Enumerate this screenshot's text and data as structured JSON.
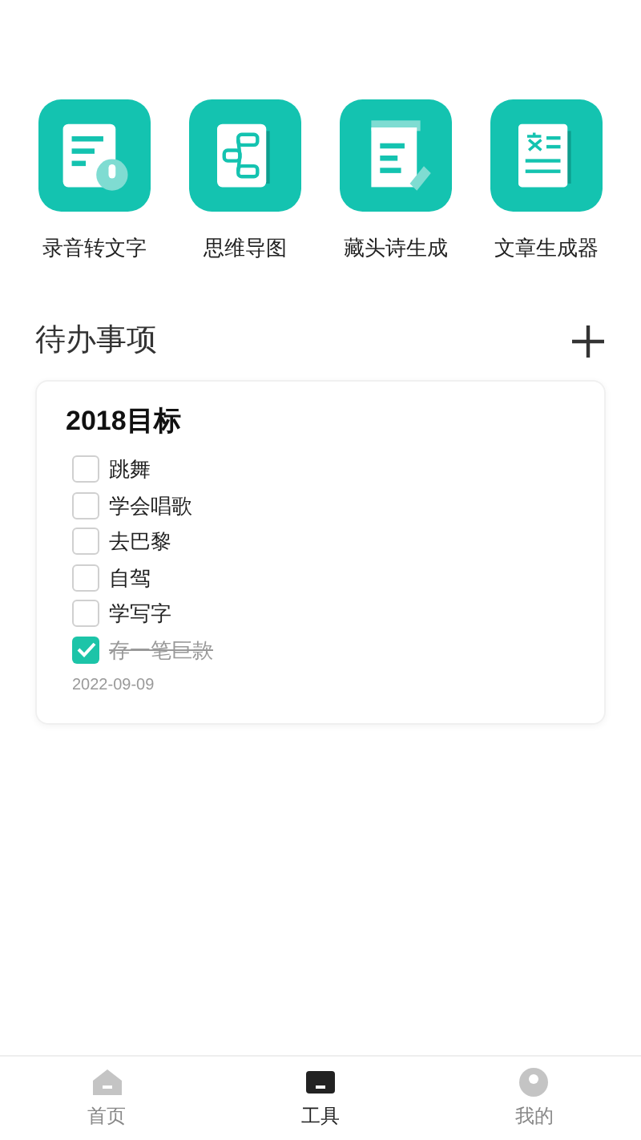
{
  "tools": [
    {
      "label": "录音转文字",
      "kind": "voice"
    },
    {
      "label": "思维导图",
      "kind": "mindmap"
    },
    {
      "label": "藏头诗生成",
      "kind": "poem"
    },
    {
      "label": "文章生成器",
      "kind": "article"
    }
  ],
  "todo": {
    "heading": "待办事项",
    "card": {
      "title": "2018目标",
      "items": [
        {
          "text": "跳舞",
          "checked": false
        },
        {
          "text": "学会唱歌",
          "checked": false
        },
        {
          "text": "去巴黎",
          "checked": false
        },
        {
          "text": "自驾",
          "checked": false
        },
        {
          "text": "学写字",
          "checked": false
        },
        {
          "text": "存一笔巨款",
          "checked": true
        }
      ],
      "date": "2022-09-09"
    }
  },
  "tabs": [
    {
      "label": "首页",
      "kind": "home",
      "selected": false
    },
    {
      "label": "工具",
      "kind": "tools",
      "selected": true
    },
    {
      "label": "我的",
      "kind": "profile",
      "selected": false
    }
  ]
}
